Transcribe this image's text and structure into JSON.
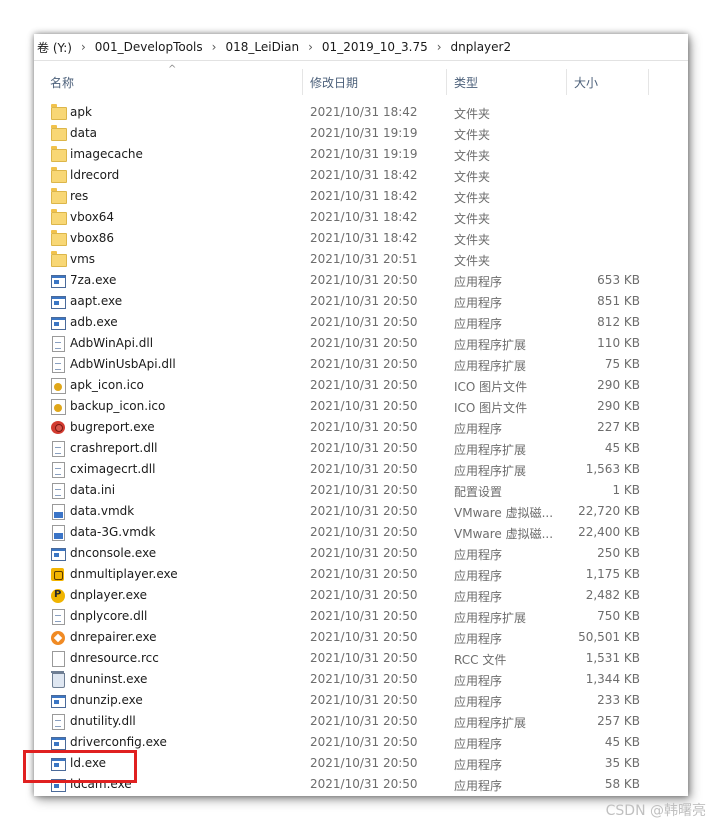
{
  "breadcrumb": [
    "卷 (Y:)",
    "001_DevelopTools",
    "018_LeiDian",
    "01_2019_10_3.75",
    "dnplayer2"
  ],
  "breadcrumb_separator": "›",
  "columns": {
    "name": "名称",
    "date": "修改日期",
    "type": "类型",
    "size": "大小"
  },
  "files": [
    {
      "icon": "folder-icon",
      "name": "apk",
      "date": "2021/10/31 18:42",
      "type": "文件夹",
      "size": ""
    },
    {
      "icon": "folder-icon",
      "name": "data",
      "date": "2021/10/31 19:19",
      "type": "文件夹",
      "size": ""
    },
    {
      "icon": "folder-icon",
      "name": "imagecache",
      "date": "2021/10/31 19:19",
      "type": "文件夹",
      "size": ""
    },
    {
      "icon": "folder-icon",
      "name": "ldrecord",
      "date": "2021/10/31 18:42",
      "type": "文件夹",
      "size": ""
    },
    {
      "icon": "folder-icon",
      "name": "res",
      "date": "2021/10/31 18:42",
      "type": "文件夹",
      "size": ""
    },
    {
      "icon": "folder-icon",
      "name": "vbox64",
      "date": "2021/10/31 18:42",
      "type": "文件夹",
      "size": ""
    },
    {
      "icon": "folder-icon",
      "name": "vbox86",
      "date": "2021/10/31 18:42",
      "type": "文件夹",
      "size": ""
    },
    {
      "icon": "folder-icon",
      "name": "vms",
      "date": "2021/10/31 20:51",
      "type": "文件夹",
      "size": ""
    },
    {
      "icon": "exe-icon",
      "name": "7za.exe",
      "date": "2021/10/31 20:50",
      "type": "应用程序",
      "size": "653 KB"
    },
    {
      "icon": "exe-icon",
      "name": "aapt.exe",
      "date": "2021/10/31 20:50",
      "type": "应用程序",
      "size": "851 KB"
    },
    {
      "icon": "exe-icon",
      "name": "adb.exe",
      "date": "2021/10/31 20:50",
      "type": "应用程序",
      "size": "812 KB"
    },
    {
      "icon": "dll-icon",
      "name": "AdbWinApi.dll",
      "date": "2021/10/31 20:50",
      "type": "应用程序扩展",
      "size": "110 KB"
    },
    {
      "icon": "dll-icon",
      "name": "AdbWinUsbApi.dll",
      "date": "2021/10/31 20:50",
      "type": "应用程序扩展",
      "size": "75 KB"
    },
    {
      "icon": "ico-file-icon",
      "name": "apk_icon.ico",
      "date": "2021/10/31 20:50",
      "type": "ICO 图片文件",
      "size": "290 KB"
    },
    {
      "icon": "ico-file-icon",
      "name": "backup_icon.ico",
      "date": "2021/10/31 20:50",
      "type": "ICO 图片文件",
      "size": "290 KB"
    },
    {
      "icon": "bug-icon",
      "name": "bugreport.exe",
      "date": "2021/10/31 20:50",
      "type": "应用程序",
      "size": "227 KB"
    },
    {
      "icon": "dll-icon",
      "name": "crashreport.dll",
      "date": "2021/10/31 20:50",
      "type": "应用程序扩展",
      "size": "45 KB"
    },
    {
      "icon": "dll-icon",
      "name": "cximagecrt.dll",
      "date": "2021/10/31 20:50",
      "type": "应用程序扩展",
      "size": "1,563 KB"
    },
    {
      "icon": "dll-icon",
      "name": "data.ini",
      "date": "2021/10/31 20:50",
      "type": "配置设置",
      "size": "1 KB"
    },
    {
      "icon": "vmdk-icon",
      "name": "data.vmdk",
      "date": "2021/10/31 20:50",
      "type": "VMware 虚拟磁...",
      "size": "22,720 KB"
    },
    {
      "icon": "vmdk-icon",
      "name": "data-3G.vmdk",
      "date": "2021/10/31 20:50",
      "type": "VMware 虚拟磁...",
      "size": "22,400 KB"
    },
    {
      "icon": "exe-icon",
      "name": "dnconsole.exe",
      "date": "2021/10/31 20:50",
      "type": "应用程序",
      "size": "250 KB"
    },
    {
      "icon": "multiplayer-icon",
      "name": "dnmultiplayer.exe",
      "date": "2021/10/31 20:50",
      "type": "应用程序",
      "size": "1,175 KB"
    },
    {
      "icon": "player-icon",
      "name": "dnplayer.exe",
      "date": "2021/10/31 20:50",
      "type": "应用程序",
      "size": "2,482 KB"
    },
    {
      "icon": "dll-icon",
      "name": "dnplycore.dll",
      "date": "2021/10/31 20:50",
      "type": "应用程序扩展",
      "size": "750 KB"
    },
    {
      "icon": "repair-icon",
      "name": "dnrepairer.exe",
      "date": "2021/10/31 20:50",
      "type": "应用程序",
      "size": "50,501 KB"
    },
    {
      "icon": "file-icon",
      "name": "dnresource.rcc",
      "date": "2021/10/31 20:50",
      "type": "RCC 文件",
      "size": "1,531 KB"
    },
    {
      "icon": "uninstall-icon",
      "name": "dnuninst.exe",
      "date": "2021/10/31 20:50",
      "type": "应用程序",
      "size": "1,344 KB"
    },
    {
      "icon": "exe-icon",
      "name": "dnunzip.exe",
      "date": "2021/10/31 20:50",
      "type": "应用程序",
      "size": "233 KB"
    },
    {
      "icon": "dll-icon",
      "name": "dnutility.dll",
      "date": "2021/10/31 20:50",
      "type": "应用程序扩展",
      "size": "257 KB"
    },
    {
      "icon": "exe-icon",
      "name": "driverconfig.exe",
      "date": "2021/10/31 20:50",
      "type": "应用程序",
      "size": "45 KB"
    },
    {
      "icon": "exe-icon",
      "name": "ld.exe",
      "date": "2021/10/31 20:50",
      "type": "应用程序",
      "size": "35 KB"
    },
    {
      "icon": "exe-icon",
      "name": "ldcam.exe",
      "date": "2021/10/31 20:50",
      "type": "应用程序",
      "size": "58 KB"
    }
  ],
  "highlighted_file": "ld.exe",
  "highlight_color": "#e02020",
  "watermark": "CSDN @韩曙亮"
}
